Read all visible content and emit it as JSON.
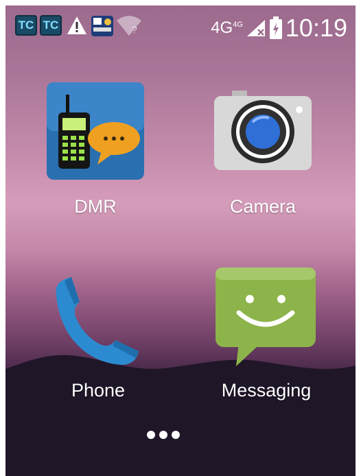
{
  "status_bar": {
    "network": "4G",
    "network_sub": "4G",
    "time": "10:19",
    "notification_icons": [
      "tc-app-icon",
      "tc-app-icon",
      "warning-icon",
      "app-thumbnail-icon",
      "wifi-unknown-icon"
    ]
  },
  "apps": [
    {
      "label": "DMR",
      "icon": "dmr-radio-icon"
    },
    {
      "label": "Camera",
      "icon": "camera-icon"
    },
    {
      "label": "Phone",
      "icon": "phone-icon"
    },
    {
      "label": "Messaging",
      "icon": "messaging-icon"
    }
  ],
  "colors": {
    "dmr_bg": "#2a6fb0",
    "camera_body": "#d8d8d8",
    "lens": "#2f6fd6",
    "phone": "#2c8bd0",
    "messaging": "#8cb44a"
  }
}
